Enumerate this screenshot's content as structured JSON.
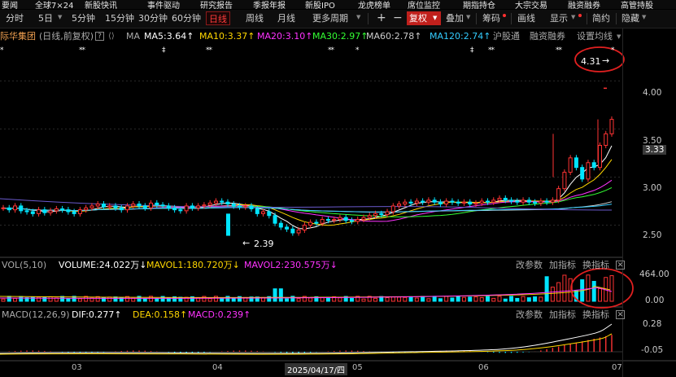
{
  "top_nav": [
    "要闻",
    "全球7×24",
    "新股快讯",
    "事件驱动",
    "研究报告",
    "季报年报",
    "新股IPO",
    "龙虎榜单",
    "席位监控",
    "期指持仓",
    "大宗交易",
    "融资融券",
    "高管持股"
  ],
  "toolbar": {
    "periods": [
      "分时",
      "5日",
      "5分钟",
      "15分钟",
      "30分钟",
      "60分钟",
      "日线",
      "周线",
      "月线",
      "更多周期"
    ],
    "active_period": "日线",
    "plus": "+",
    "minus": "−",
    "fq": "复权",
    "overlay": "叠加",
    "chip": "筹码",
    "draw": "画线",
    "show": "显示",
    "simple": "简约",
    "hide": "隐藏"
  },
  "main_header": {
    "stock": "际华集团",
    "mode": "(日线,前复权)",
    "help": "?",
    "ma_label": "MA",
    "ma5": "MA5:3.64↑",
    "ma10": "MA10:3.37↑",
    "ma20": "MA20:3.10↑",
    "ma30": "MA30:2.97↑",
    "ma60": "MA60:2.78↑",
    "ma120": "MA120:2.74↑",
    "hgt": "沪股通",
    "rzrq": "融资融券",
    "set_ma": "设置均线"
  },
  "annotations": {
    "high": "4.31",
    "low": "2.39"
  },
  "price_axis": [
    "4.00",
    "3.50",
    "3.33",
    "3.00",
    "2.50"
  ],
  "vol_header": {
    "name": "VOL(5,10)",
    "volume": "VOLUME:24.022万↓",
    "mavol1": "MAVOL1:180.720万↓",
    "mavol2": "MAVOL2:230.575万↓",
    "edit": "改参数",
    "add": "加指标",
    "switch": "换指标"
  },
  "vol_axis": [
    "464.00",
    "0.00"
  ],
  "macd_header": {
    "name": "MACD(12,26,9)",
    "dif": "DIF:0.277↑",
    "dea": "DEA:0.158↑",
    "macd": "MACD:0.239↑",
    "edit": "改参数",
    "add": "加指标",
    "switch": "换指标"
  },
  "macd_axis": [
    "0.28",
    "-0.05"
  ],
  "x_axis": [
    "03",
    "04",
    "2025/04/17/四",
    "05",
    "06",
    "07"
  ],
  "colors": {
    "up": "#ff3333",
    "down": "#00e5ff",
    "ma5": "#ffffff",
    "ma10": "#ffd700",
    "ma20": "#ff33ff",
    "ma30": "#33ff33",
    "ma60": "#cccccc",
    "ma120": "#33ccff",
    "highlight": "#e02020"
  },
  "chart_data": {
    "type": "candlestick",
    "price_ylim": [
      2.2,
      4.35
    ],
    "closes_approx": [
      2.68,
      2.66,
      2.7,
      2.65,
      2.64,
      2.62,
      2.66,
      2.63,
      2.65,
      2.67,
      2.66,
      2.64,
      2.62,
      2.66,
      2.68,
      2.7,
      2.72,
      2.69,
      2.7,
      2.68,
      2.66,
      2.7,
      2.72,
      2.7,
      2.68,
      2.73,
      2.71,
      2.7,
      2.68,
      2.66,
      2.65,
      2.7,
      2.68,
      2.7,
      2.71,
      2.73,
      2.75,
      2.74,
      2.72,
      2.7,
      2.69,
      2.7,
      2.67,
      2.62,
      2.64,
      2.6,
      2.52,
      2.48,
      2.46,
      2.42,
      2.45,
      2.5,
      2.53,
      2.52,
      2.56,
      2.55,
      2.56,
      2.58,
      2.55,
      2.54,
      2.56,
      2.58,
      2.6,
      2.62,
      2.61,
      2.64,
      2.7,
      2.72,
      2.74,
      2.73,
      2.75,
      2.74,
      2.76,
      2.74,
      2.72,
      2.75,
      2.74,
      2.73,
      2.74,
      2.72,
      2.73,
      2.75,
      2.74,
      2.76,
      2.78,
      2.76,
      2.75,
      2.74,
      2.76,
      2.74,
      2.73,
      2.75,
      2.74,
      2.76,
      2.88,
      3.05,
      3.2,
      3.1,
      2.98,
      3.15,
      3.1,
      3.33,
      3.45,
      3.6
    ],
    "high": 4.31,
    "low": 2.39,
    "last": 3.33
  }
}
